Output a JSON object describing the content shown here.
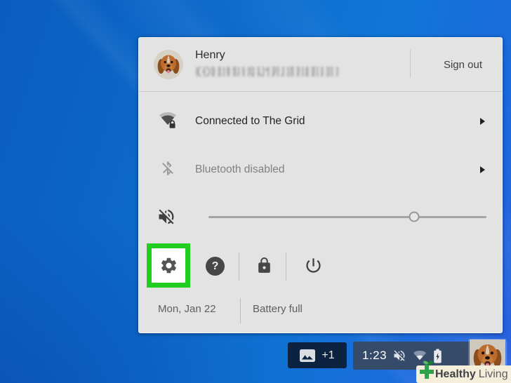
{
  "menu": {
    "user": {
      "name": "Henry",
      "sign_out_label": "Sign out"
    },
    "network": {
      "label": "Connected to The Grid"
    },
    "bluetooth": {
      "label": "Bluetooth disabled"
    },
    "volume": {
      "percent": 74,
      "muted": true
    },
    "buttons": {
      "help_glyph": "?"
    },
    "footer": {
      "date": "Mon, Jan 22",
      "battery_status": "Battery full"
    }
  },
  "shelf": {
    "notification_badge": {
      "count": "+1"
    },
    "tray": {
      "time": "1:23"
    }
  },
  "watermark": {
    "bold": "Healthy",
    "light": "Living"
  },
  "icons": {
    "wifi_secured": "wifi fan with padlock",
    "bluetooth_disabled": "bluetooth rune with slash",
    "volume_muted": "speaker with slash",
    "settings": "gear",
    "help": "question mark circle",
    "lock": "padlock",
    "power": "power symbol",
    "photo": "image thumbnail",
    "battery_charging": "battery with bolt"
  },
  "colors": {
    "highlight_green": "#1fce1f",
    "menu_bg": "#e3e3e3",
    "desktop_blue": "#0f76d6",
    "shelf_badge_bg": "#0b2240",
    "tray_bg": "#384861"
  }
}
